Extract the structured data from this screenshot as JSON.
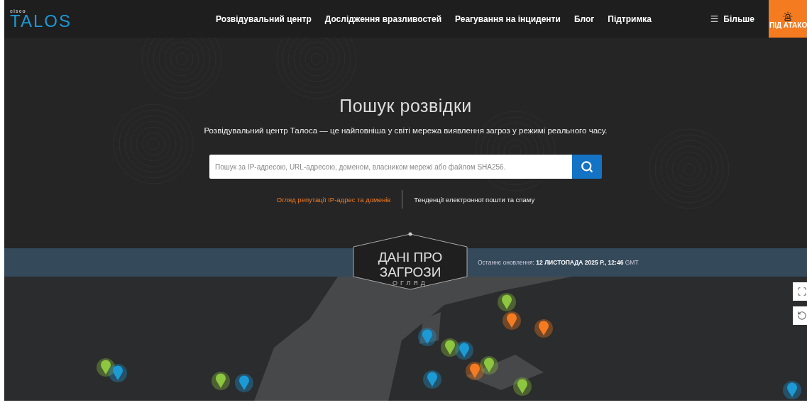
{
  "nav": {
    "logo_top": "cisco",
    "logo": "TALOS",
    "links": [
      {
        "label": "Розвідувальний центр"
      },
      {
        "label": "Дослідження вразливостей"
      },
      {
        "label": "Реагування на інциденти"
      },
      {
        "label": "Блог"
      },
      {
        "label": "Підтримка"
      }
    ],
    "more": "Більше",
    "attack_badge": "ПІД АТАКО"
  },
  "hero": {
    "title": "Пошук розвідки",
    "subtitle": "Розвідувальний центр Талоса — це найповніша у світі мережа виявлення загроз у режимі реального часу.",
    "search": {
      "placeholder": "Пошук за IP-адресою, URL-адресою, доменом, власником мережі або файлом SHA256."
    },
    "links": [
      {
        "label": "Огляд репутації IP-адрес та доменів",
        "selected": true
      },
      {
        "label": "Тенденції електронної пошти та спаму",
        "selected": false
      }
    ]
  },
  "band": {
    "badge_lines": [
      "ДАНІ ПРО",
      "ЗАГРОЗИ"
    ],
    "badge_subtitle": "ОГЛЯД",
    "updated": "Останнє оновлення: **12 ЛИСТОПАДА 2025 Р., 12:46** GMT"
  }
}
